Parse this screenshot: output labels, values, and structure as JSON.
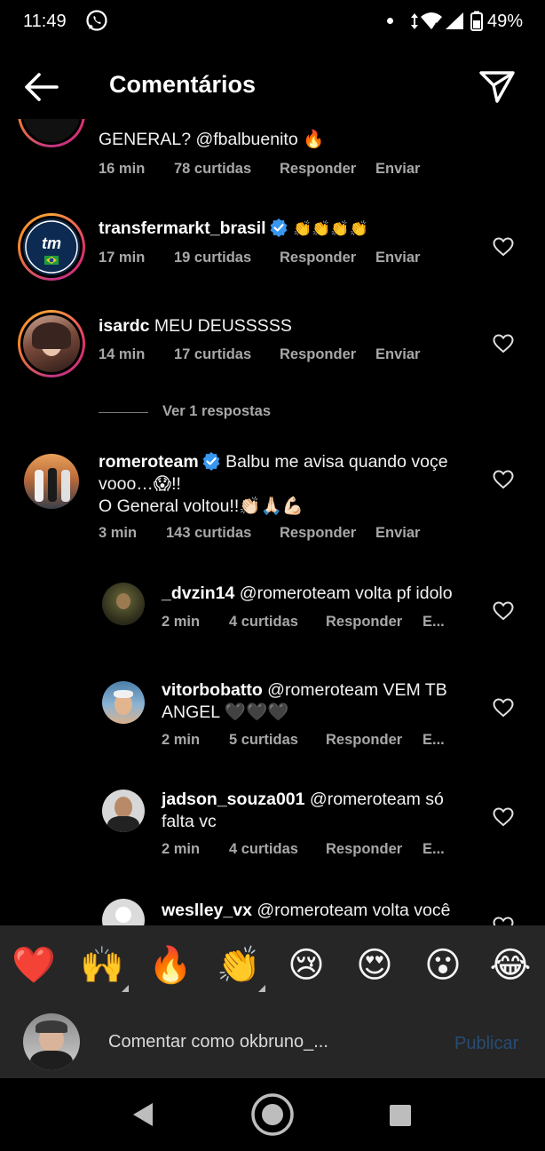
{
  "status_bar": {
    "time": "11:49",
    "battery": "49%",
    "wifi_badge": "4"
  },
  "header": {
    "title": "Comentários"
  },
  "comments": [
    {
      "text": "GENERAL? @fbalbuenito 🔥",
      "time": "16 min",
      "likes": "78 curtidas",
      "reply": "Responder",
      "send": "Enviar"
    },
    {
      "username": "transfermarkt_brasil",
      "verified": true,
      "text": "👏👏👏👏",
      "time": "17 min",
      "likes": "19 curtidas",
      "reply": "Responder",
      "send": "Enviar",
      "avatar_logo": "tm"
    },
    {
      "username": "isardc",
      "text": "MEU DEUSSSSS",
      "time": "14 min",
      "likes": "17 curtidas",
      "reply": "Responder",
      "send": "Enviar",
      "replies_toggle": "Ver 1 respostas"
    },
    {
      "username": "romeroteam",
      "verified": true,
      "text_line1": "Balbu me avisa quando voçe",
      "text_line2": "vooo…😱!!",
      "text_line3": "O General voltou!!👏🏻🙏🏻💪🏻",
      "time": "3 min",
      "likes": "143 curtidas",
      "reply": "Responder",
      "send": "Enviar"
    }
  ],
  "replies": [
    {
      "username": "_dvzin14",
      "text": "@romeroteam volta pf idolo",
      "time": "2 min",
      "likes": "4 curtidas",
      "reply": "Responder",
      "send": "E..."
    },
    {
      "username": "vitorbobatto",
      "text_line1": "@romeroteam VEM TB",
      "text_line2": "ANGEL 🖤🖤🖤",
      "time": "2 min",
      "likes": "5 curtidas",
      "reply": "Responder",
      "send": "E..."
    },
    {
      "username": "jadson_souza001",
      "text_line1": "@romeroteam só",
      "text_line2": "falta vc",
      "time": "2 min",
      "likes": "4 curtidas",
      "reply": "Responder",
      "send": "E..."
    },
    {
      "username": "weslley_vx",
      "text": "@romeroteam volta você"
    }
  ],
  "reactions": [
    "❤️",
    "🙌",
    "🔥",
    "👏",
    "😢",
    "😍",
    "😮",
    "😂"
  ],
  "composer": {
    "placeholder": "Comentar como okbruno_...",
    "publish": "Publicar"
  },
  "colors": {
    "background": "#000000",
    "panel": "#262626",
    "meta": "#a8a8a8",
    "verified": "#3897f0",
    "publish_disabled": "#284c73"
  }
}
